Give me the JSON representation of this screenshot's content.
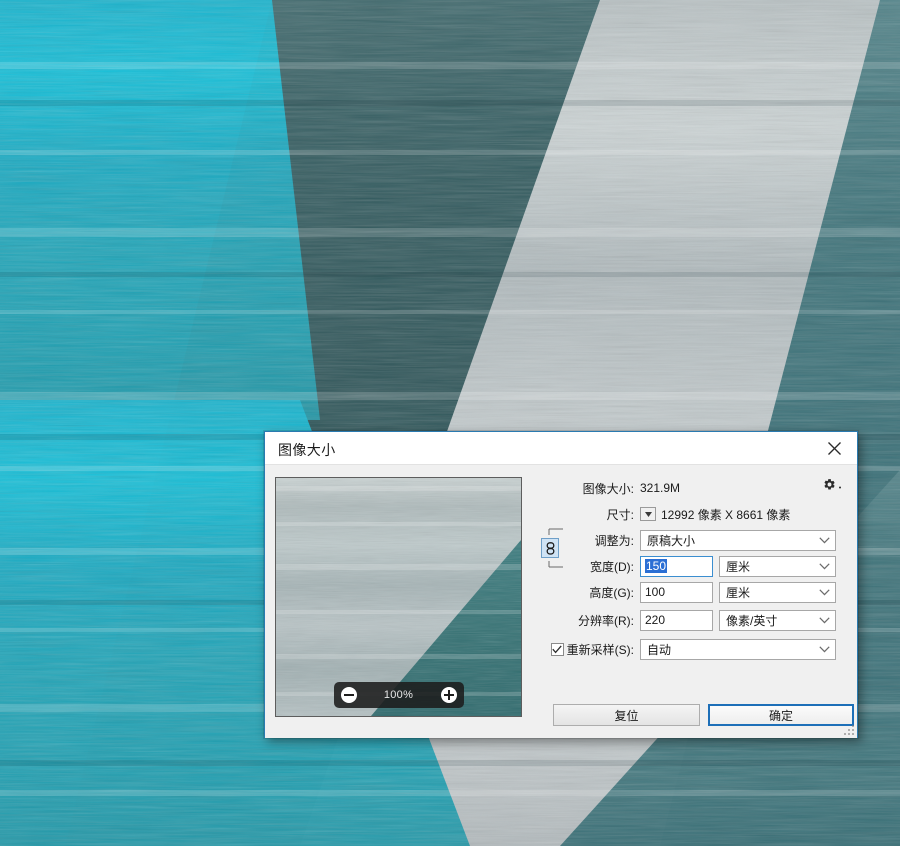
{
  "desktop": {
    "wallpaper_name": "abstract-teal-stripes-artwork",
    "colors": {
      "cyan": "#17a8c4",
      "dark_teal": "#2c5a5e",
      "light_gray": "#b7c0c2",
      "mid_teal": "#35707a",
      "deep_teal": "#2d6771"
    }
  },
  "dialog": {
    "title": "图像大小",
    "close_label": "✕",
    "preview": {
      "zoom_level": "100%",
      "zoom_out_label": "−",
      "zoom_in_label": "+"
    },
    "info": {
      "image_size_label": "图像大小:",
      "image_size_value": "321.9M",
      "gear_icon": "gear-icon",
      "dimensions_label": "尺寸:",
      "dimensions_value": "12992 像素  X  8661 像素"
    },
    "fields": {
      "fit_to": {
        "label": "调整为:",
        "value": "原稿大小"
      },
      "width": {
        "label": "宽度(D):",
        "value": "150",
        "unit": "厘米",
        "selected": true
      },
      "height": {
        "label": "高度(G):",
        "value": "100",
        "unit": "厘米"
      },
      "resolution": {
        "label": "分辨率(R):",
        "value": "220",
        "unit": "像素/英寸"
      },
      "resample": {
        "label": "重新采样(S):",
        "value": "自动",
        "checked": true
      }
    },
    "link_icon": "chain-link-icon",
    "buttons": {
      "reset": "复位",
      "ok": "确定"
    }
  }
}
